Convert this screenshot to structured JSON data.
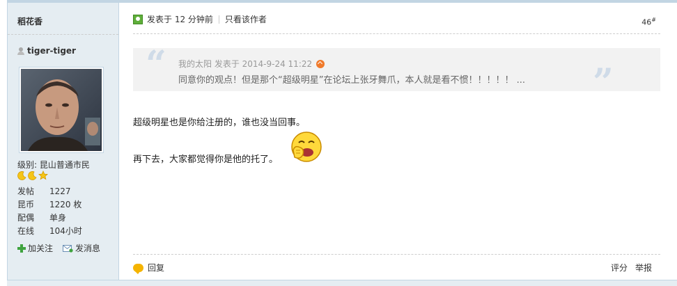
{
  "sidebar": {
    "prev_author": "稻花香",
    "author": "tiger-tiger",
    "level": "级别: 昆山普通市民",
    "stats": [
      {
        "key": "发帖",
        "value": "1227"
      },
      {
        "key": "昆币",
        "value": "1220 枚"
      },
      {
        "key": "配偶",
        "value": "单身"
      },
      {
        "key": "在线",
        "value": "104小时"
      }
    ],
    "follow_label": "加关注",
    "message_label": "发消息"
  },
  "post": {
    "posted": "发表于 12 分钟前",
    "only_author": "只看该作者",
    "floor": "46",
    "floor_sup": "#",
    "quote": {
      "meta": "我的太阳 发表于 2014-9-24 11:22",
      "text": "同意你的观点！但是那个“超级明星”在论坛上张牙舞爪，本人就是看不惯！！！！！ ..."
    },
    "body_1": "超级明星也是你给注册的，谁也没当回事。",
    "body_2": "再下去，大家都觉得你是他的托了。",
    "reply_label": "回复",
    "rate_label": "评分",
    "report_label": "举报"
  },
  "colors": {
    "sidebar_bg": "#e5edf2",
    "border": "#c2d5e3",
    "quote_bg": "#f2f2f2"
  }
}
